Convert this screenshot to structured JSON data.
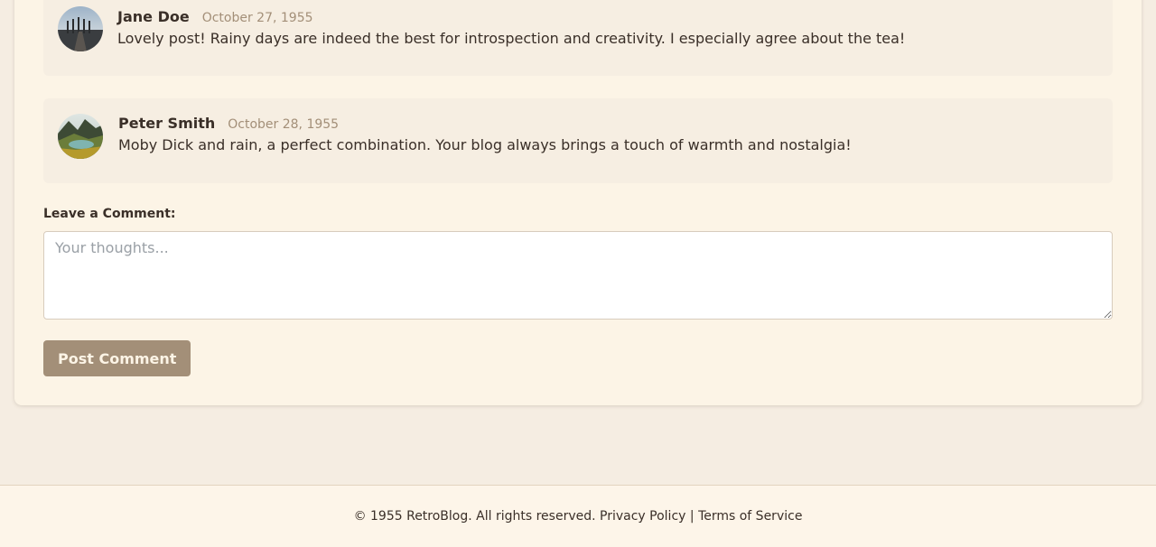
{
  "comments": [
    {
      "author": "Jane Doe",
      "date": "October 27, 1955",
      "text": "Lovely post! Rainy days are indeed the best for introspection and creativity. I especially agree about the tea!",
      "avatar": "avatar-photo-dock"
    },
    {
      "author": "Peter Smith",
      "date": "October 28, 1955",
      "text": "Moby Dick and rain, a perfect combination. Your blog always brings a touch of warmth and nostalgia!",
      "avatar": "avatar-photo-mountain-lake"
    }
  ],
  "comment_form": {
    "label": "Leave a Comment:",
    "placeholder": "Your thoughts...",
    "value": "",
    "submit_label": "Post Comment"
  },
  "footer": {
    "copyright": "© 1955 RetroBlog. All rights reserved.",
    "privacy_link": "Privacy Policy",
    "separator": "|",
    "terms_link": "Terms of Service"
  },
  "colors": {
    "page_background": "#f5ede2",
    "card_background": "#fcf4e6",
    "comment_background": "#f6eee2",
    "accent": "#a38f78",
    "text": "#3a2f28",
    "date_text": "#a38f78"
  }
}
